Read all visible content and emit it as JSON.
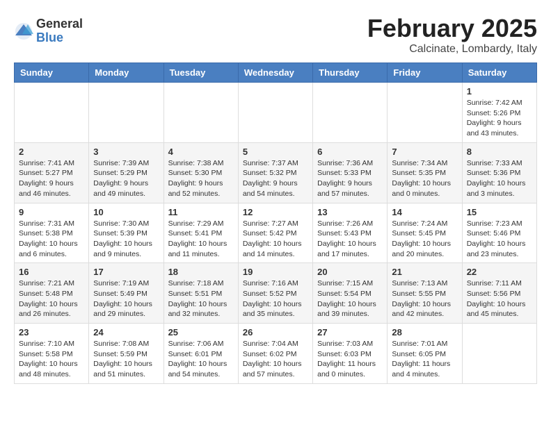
{
  "header": {
    "logo_general": "General",
    "logo_blue": "Blue",
    "month_title": "February 2025",
    "location": "Calcinate, Lombardy, Italy"
  },
  "weekdays": [
    "Sunday",
    "Monday",
    "Tuesday",
    "Wednesday",
    "Thursday",
    "Friday",
    "Saturday"
  ],
  "weeks": [
    [
      {
        "day": "",
        "info": ""
      },
      {
        "day": "",
        "info": ""
      },
      {
        "day": "",
        "info": ""
      },
      {
        "day": "",
        "info": ""
      },
      {
        "day": "",
        "info": ""
      },
      {
        "day": "",
        "info": ""
      },
      {
        "day": "1",
        "info": "Sunrise: 7:42 AM\nSunset: 5:26 PM\nDaylight: 9 hours and 43 minutes."
      }
    ],
    [
      {
        "day": "2",
        "info": "Sunrise: 7:41 AM\nSunset: 5:27 PM\nDaylight: 9 hours and 46 minutes."
      },
      {
        "day": "3",
        "info": "Sunrise: 7:39 AM\nSunset: 5:29 PM\nDaylight: 9 hours and 49 minutes."
      },
      {
        "day": "4",
        "info": "Sunrise: 7:38 AM\nSunset: 5:30 PM\nDaylight: 9 hours and 52 minutes."
      },
      {
        "day": "5",
        "info": "Sunrise: 7:37 AM\nSunset: 5:32 PM\nDaylight: 9 hours and 54 minutes."
      },
      {
        "day": "6",
        "info": "Sunrise: 7:36 AM\nSunset: 5:33 PM\nDaylight: 9 hours and 57 minutes."
      },
      {
        "day": "7",
        "info": "Sunrise: 7:34 AM\nSunset: 5:35 PM\nDaylight: 10 hours and 0 minutes."
      },
      {
        "day": "8",
        "info": "Sunrise: 7:33 AM\nSunset: 5:36 PM\nDaylight: 10 hours and 3 minutes."
      }
    ],
    [
      {
        "day": "9",
        "info": "Sunrise: 7:31 AM\nSunset: 5:38 PM\nDaylight: 10 hours and 6 minutes."
      },
      {
        "day": "10",
        "info": "Sunrise: 7:30 AM\nSunset: 5:39 PM\nDaylight: 10 hours and 9 minutes."
      },
      {
        "day": "11",
        "info": "Sunrise: 7:29 AM\nSunset: 5:41 PM\nDaylight: 10 hours and 11 minutes."
      },
      {
        "day": "12",
        "info": "Sunrise: 7:27 AM\nSunset: 5:42 PM\nDaylight: 10 hours and 14 minutes."
      },
      {
        "day": "13",
        "info": "Sunrise: 7:26 AM\nSunset: 5:43 PM\nDaylight: 10 hours and 17 minutes."
      },
      {
        "day": "14",
        "info": "Sunrise: 7:24 AM\nSunset: 5:45 PM\nDaylight: 10 hours and 20 minutes."
      },
      {
        "day": "15",
        "info": "Sunrise: 7:23 AM\nSunset: 5:46 PM\nDaylight: 10 hours and 23 minutes."
      }
    ],
    [
      {
        "day": "16",
        "info": "Sunrise: 7:21 AM\nSunset: 5:48 PM\nDaylight: 10 hours and 26 minutes."
      },
      {
        "day": "17",
        "info": "Sunrise: 7:19 AM\nSunset: 5:49 PM\nDaylight: 10 hours and 29 minutes."
      },
      {
        "day": "18",
        "info": "Sunrise: 7:18 AM\nSunset: 5:51 PM\nDaylight: 10 hours and 32 minutes."
      },
      {
        "day": "19",
        "info": "Sunrise: 7:16 AM\nSunset: 5:52 PM\nDaylight: 10 hours and 35 minutes."
      },
      {
        "day": "20",
        "info": "Sunrise: 7:15 AM\nSunset: 5:54 PM\nDaylight: 10 hours and 39 minutes."
      },
      {
        "day": "21",
        "info": "Sunrise: 7:13 AM\nSunset: 5:55 PM\nDaylight: 10 hours and 42 minutes."
      },
      {
        "day": "22",
        "info": "Sunrise: 7:11 AM\nSunset: 5:56 PM\nDaylight: 10 hours and 45 minutes."
      }
    ],
    [
      {
        "day": "23",
        "info": "Sunrise: 7:10 AM\nSunset: 5:58 PM\nDaylight: 10 hours and 48 minutes."
      },
      {
        "day": "24",
        "info": "Sunrise: 7:08 AM\nSunset: 5:59 PM\nDaylight: 10 hours and 51 minutes."
      },
      {
        "day": "25",
        "info": "Sunrise: 7:06 AM\nSunset: 6:01 PM\nDaylight: 10 hours and 54 minutes."
      },
      {
        "day": "26",
        "info": "Sunrise: 7:04 AM\nSunset: 6:02 PM\nDaylight: 10 hours and 57 minutes."
      },
      {
        "day": "27",
        "info": "Sunrise: 7:03 AM\nSunset: 6:03 PM\nDaylight: 11 hours and 0 minutes."
      },
      {
        "day": "28",
        "info": "Sunrise: 7:01 AM\nSunset: 6:05 PM\nDaylight: 11 hours and 4 minutes."
      },
      {
        "day": "",
        "info": ""
      }
    ]
  ]
}
